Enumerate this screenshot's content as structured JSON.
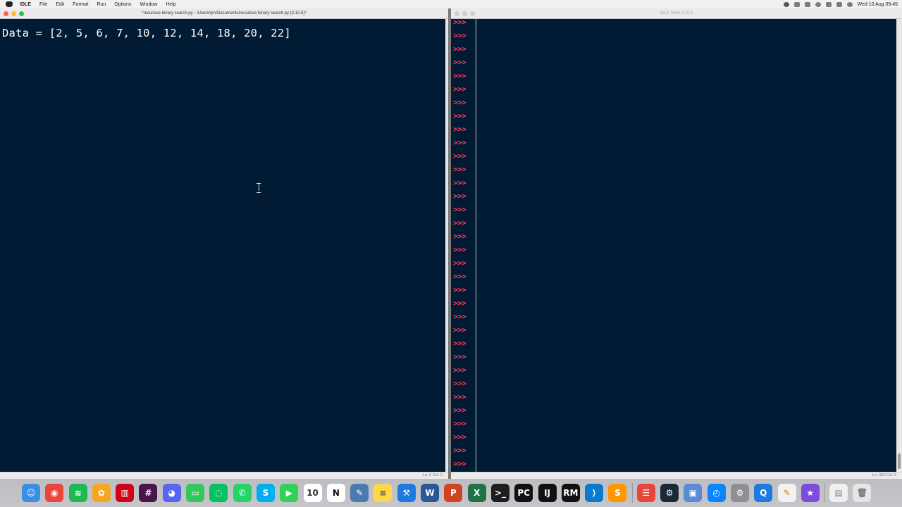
{
  "menubar": {
    "menus": [
      "IDLE",
      "File",
      "Edit",
      "Format",
      "Run",
      "Options",
      "Window",
      "Help"
    ],
    "clock": "Wed 10 Aug 09:45",
    "status_icons": [
      "record-icon",
      "cloud-icon",
      "tweet-icon",
      "timer-icon",
      "wifi-icon",
      "search-icon",
      "control-center-icon"
    ]
  },
  "editor": {
    "title": "*recursive binary search.py - /Users/rjm/Documents/recursive binary search.py (3.10.5)*",
    "code": "Data = [2, 5, 6, 7, 10, 12, 14, 18, 20, 22]",
    "status": "Ln: 3  Col: 0"
  },
  "shell": {
    "title": "IDLE Shell 3.10.5",
    "prompt": ">>>",
    "status": "Ln: 354  Col: 0"
  },
  "dock": {
    "icons": [
      {
        "name": "finder-icon",
        "color": "#3a8ee6",
        "glyph": "☺"
      },
      {
        "name": "chrome-icon",
        "color": "#e8453c",
        "glyph": "◉"
      },
      {
        "name": "spotify-icon",
        "color": "#1db954",
        "glyph": "≋"
      },
      {
        "name": "mindnode-icon",
        "color": "#f5a623",
        "glyph": "✿"
      },
      {
        "name": "mainstage-icon",
        "color": "#d0021b",
        "glyph": "▥"
      },
      {
        "name": "slack-icon",
        "color": "#4a154b",
        "glyph": "#"
      },
      {
        "name": "discord-icon",
        "color": "#5865f2",
        "glyph": "◕"
      },
      {
        "name": "messages-icon",
        "color": "#34c759",
        "glyph": "▭"
      },
      {
        "name": "wechat-icon",
        "color": "#07c160",
        "glyph": "◌"
      },
      {
        "name": "whatsapp-icon",
        "color": "#25d366",
        "glyph": "✆"
      },
      {
        "name": "skype-icon",
        "color": "#00aff0",
        "glyph": "S"
      },
      {
        "name": "facetime-icon",
        "color": "#30d158",
        "glyph": "▶"
      },
      {
        "name": "calendar-icon",
        "color": "#ffffff",
        "glyph": "10",
        "text_color": "#333"
      },
      {
        "name": "notion-icon",
        "color": "#ffffff",
        "glyph": "N",
        "text_color": "#111"
      },
      {
        "name": "idle-icon",
        "color": "#4b7ab0",
        "glyph": "✎"
      },
      {
        "name": "notes-icon",
        "color": "#ffd84a",
        "glyph": "≡",
        "text_color": "#555"
      },
      {
        "name": "xcode-icon",
        "color": "#1c7ae0",
        "glyph": "⚒"
      },
      {
        "name": "word-icon",
        "color": "#2b579a",
        "glyph": "W"
      },
      {
        "name": "powerpoint-icon",
        "color": "#d04423",
        "glyph": "P"
      },
      {
        "name": "excel-icon",
        "color": "#217346",
        "glyph": "X"
      },
      {
        "name": "terminal-icon",
        "color": "#1e1e1e",
        "glyph": ">_"
      },
      {
        "name": "pycharm-icon",
        "color": "#111111",
        "glyph": "PC"
      },
      {
        "name": "intellij-icon",
        "color": "#111111",
        "glyph": "IJ"
      },
      {
        "name": "rubymine-icon",
        "color": "#111111",
        "glyph": "RM"
      },
      {
        "name": "vscode-icon",
        "color": "#0a7acc",
        "glyph": "⟩"
      },
      {
        "name": "sublime-icon",
        "color": "#ff9800",
        "glyph": "S"
      },
      {
        "name": "separator",
        "color": "",
        "glyph": ""
      },
      {
        "name": "scrobbles-icon",
        "color": "#e8453c",
        "glyph": "☰"
      },
      {
        "name": "steam-icon",
        "color": "#1b2838",
        "glyph": "⚙"
      },
      {
        "name": "screen-sharing-icon",
        "color": "#5b8bd8",
        "glyph": "▣"
      },
      {
        "name": "activity-icon",
        "color": "#0a84ff",
        "glyph": "◴"
      },
      {
        "name": "system-preferences-icon",
        "color": "#8e8e93",
        "glyph": "⚙"
      },
      {
        "name": "quicktime-icon",
        "color": "#1c7ae0",
        "glyph": "Q"
      },
      {
        "name": "script-editor-icon",
        "color": "#f2f2f2",
        "glyph": "✎",
        "text_color": "#c08000"
      },
      {
        "name": "imovie-icon",
        "color": "#7d4cdb",
        "glyph": "★"
      },
      {
        "name": "separator",
        "color": "",
        "glyph": ""
      },
      {
        "name": "downloads-icon",
        "color": "#f0f0f0",
        "glyph": "▤",
        "text_color": "#888"
      },
      {
        "name": "trash-icon",
        "color": "#e5e5e5",
        "glyph": "🗑",
        "text_color": "#777"
      }
    ]
  }
}
